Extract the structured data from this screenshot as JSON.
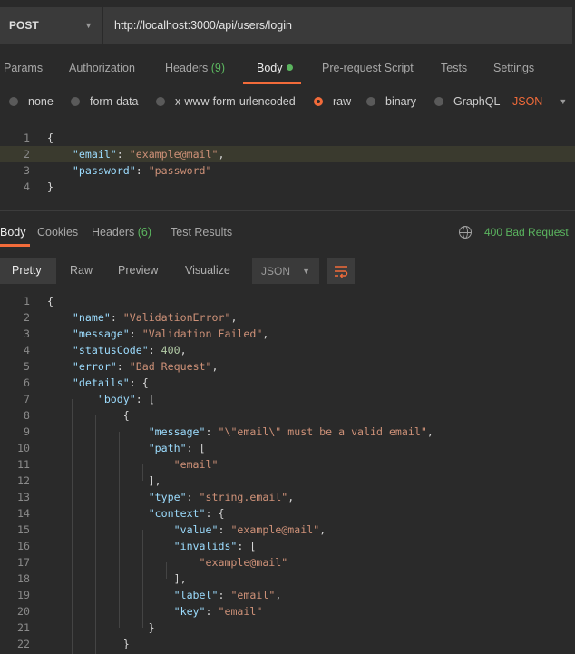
{
  "request": {
    "method": "POST",
    "url": "http://localhost:3000/api/users/login"
  },
  "request_tabs": [
    {
      "label": "Params"
    },
    {
      "label": "Authorization"
    },
    {
      "label": "Headers",
      "count": "(9)"
    },
    {
      "label": "Body",
      "active": true
    },
    {
      "label": "Pre-request Script"
    },
    {
      "label": "Tests"
    },
    {
      "label": "Settings"
    }
  ],
  "body_types": [
    {
      "label": "none"
    },
    {
      "label": "form-data"
    },
    {
      "label": "x-www-form-urlencoded"
    },
    {
      "label": "raw",
      "selected": true
    },
    {
      "label": "binary"
    },
    {
      "label": "GraphQL"
    }
  ],
  "raw_format": "JSON",
  "request_body": [
    {
      "n": "1",
      "t": [
        [
          "p",
          "{"
        ]
      ]
    },
    {
      "n": "2",
      "t": [
        [
          "p",
          "    "
        ],
        [
          "k",
          "\"email\""
        ],
        [
          "p",
          ": "
        ],
        [
          "s",
          "\"example@mail\""
        ],
        [
          "p",
          ","
        ]
      ]
    },
    {
      "n": "3",
      "t": [
        [
          "p",
          "    "
        ],
        [
          "k",
          "\"password\""
        ],
        [
          "p",
          ": "
        ],
        [
          "s",
          "\"password\""
        ]
      ]
    },
    {
      "n": "4",
      "t": [
        [
          "p",
          "}"
        ]
      ]
    }
  ],
  "response_tabs": [
    {
      "label": "Body",
      "active": true
    },
    {
      "label": "Cookies"
    },
    {
      "label": "Headers",
      "count": "(6)"
    },
    {
      "label": "Test Results"
    }
  ],
  "response_status": "400 Bad Request",
  "view_modes": [
    {
      "label": "Pretty",
      "active": true
    },
    {
      "label": "Raw"
    },
    {
      "label": "Preview"
    },
    {
      "label": "Visualize"
    }
  ],
  "response_format": "JSON",
  "response_body": [
    {
      "n": "1",
      "t": [
        [
          "p",
          "{"
        ]
      ]
    },
    {
      "n": "2",
      "t": [
        [
          "p",
          "    "
        ],
        [
          "k",
          "\"name\""
        ],
        [
          "p",
          ": "
        ],
        [
          "s",
          "\"ValidationError\""
        ],
        [
          "p",
          ","
        ]
      ]
    },
    {
      "n": "3",
      "t": [
        [
          "p",
          "    "
        ],
        [
          "k",
          "\"message\""
        ],
        [
          "p",
          ": "
        ],
        [
          "s",
          "\"Validation Failed\""
        ],
        [
          "p",
          ","
        ]
      ]
    },
    {
      "n": "4",
      "t": [
        [
          "p",
          "    "
        ],
        [
          "k",
          "\"statusCode\""
        ],
        [
          "p",
          ": "
        ],
        [
          "n",
          "400"
        ],
        [
          "p",
          ","
        ]
      ]
    },
    {
      "n": "5",
      "t": [
        [
          "p",
          "    "
        ],
        [
          "k",
          "\"error\""
        ],
        [
          "p",
          ": "
        ],
        [
          "s",
          "\"Bad Request\""
        ],
        [
          "p",
          ","
        ]
      ]
    },
    {
      "n": "6",
      "t": [
        [
          "p",
          "    "
        ],
        [
          "k",
          "\"details\""
        ],
        [
          "p",
          ": {"
        ]
      ]
    },
    {
      "n": "7",
      "t": [
        [
          "p",
          "        "
        ],
        [
          "k",
          "\"body\""
        ],
        [
          "p",
          ": ["
        ]
      ]
    },
    {
      "n": "8",
      "t": [
        [
          "p",
          "            {"
        ]
      ]
    },
    {
      "n": "9",
      "t": [
        [
          "p",
          "                "
        ],
        [
          "k",
          "\"message\""
        ],
        [
          "p",
          ": "
        ],
        [
          "s",
          "\"\\\"email\\\" must be a valid email\""
        ],
        [
          "p",
          ","
        ]
      ]
    },
    {
      "n": "10",
      "t": [
        [
          "p",
          "                "
        ],
        [
          "k",
          "\"path\""
        ],
        [
          "p",
          ": ["
        ]
      ]
    },
    {
      "n": "11",
      "t": [
        [
          "p",
          "                    "
        ],
        [
          "s",
          "\"email\""
        ]
      ]
    },
    {
      "n": "12",
      "t": [
        [
          "p",
          "                ],"
        ]
      ]
    },
    {
      "n": "13",
      "t": [
        [
          "p",
          "                "
        ],
        [
          "k",
          "\"type\""
        ],
        [
          "p",
          ": "
        ],
        [
          "s",
          "\"string.email\""
        ],
        [
          "p",
          ","
        ]
      ]
    },
    {
      "n": "14",
      "t": [
        [
          "p",
          "                "
        ],
        [
          "k",
          "\"context\""
        ],
        [
          "p",
          ": {"
        ]
      ]
    },
    {
      "n": "15",
      "t": [
        [
          "p",
          "                    "
        ],
        [
          "k",
          "\"value\""
        ],
        [
          "p",
          ": "
        ],
        [
          "s",
          "\"example@mail\""
        ],
        [
          "p",
          ","
        ]
      ]
    },
    {
      "n": "16",
      "t": [
        [
          "p",
          "                    "
        ],
        [
          "k",
          "\"invalids\""
        ],
        [
          "p",
          ": ["
        ]
      ]
    },
    {
      "n": "17",
      "t": [
        [
          "p",
          "                        "
        ],
        [
          "s",
          "\"example@mail\""
        ]
      ]
    },
    {
      "n": "18",
      "t": [
        [
          "p",
          "                    ],"
        ]
      ]
    },
    {
      "n": "19",
      "t": [
        [
          "p",
          "                    "
        ],
        [
          "k",
          "\"label\""
        ],
        [
          "p",
          ": "
        ],
        [
          "s",
          "\"email\""
        ],
        [
          "p",
          ","
        ]
      ]
    },
    {
      "n": "20",
      "t": [
        [
          "p",
          "                    "
        ],
        [
          "k",
          "\"key\""
        ],
        [
          "p",
          ": "
        ],
        [
          "s",
          "\"email\""
        ]
      ]
    },
    {
      "n": "21",
      "t": [
        [
          "p",
          "                }"
        ]
      ]
    },
    {
      "n": "22",
      "t": [
        [
          "p",
          "            }"
        ]
      ]
    }
  ],
  "colors": {
    "accent": "#f26b3a",
    "success": "#5bb55f",
    "key": "#9cdcfe",
    "string": "#ce9178",
    "number": "#b5cea8"
  }
}
